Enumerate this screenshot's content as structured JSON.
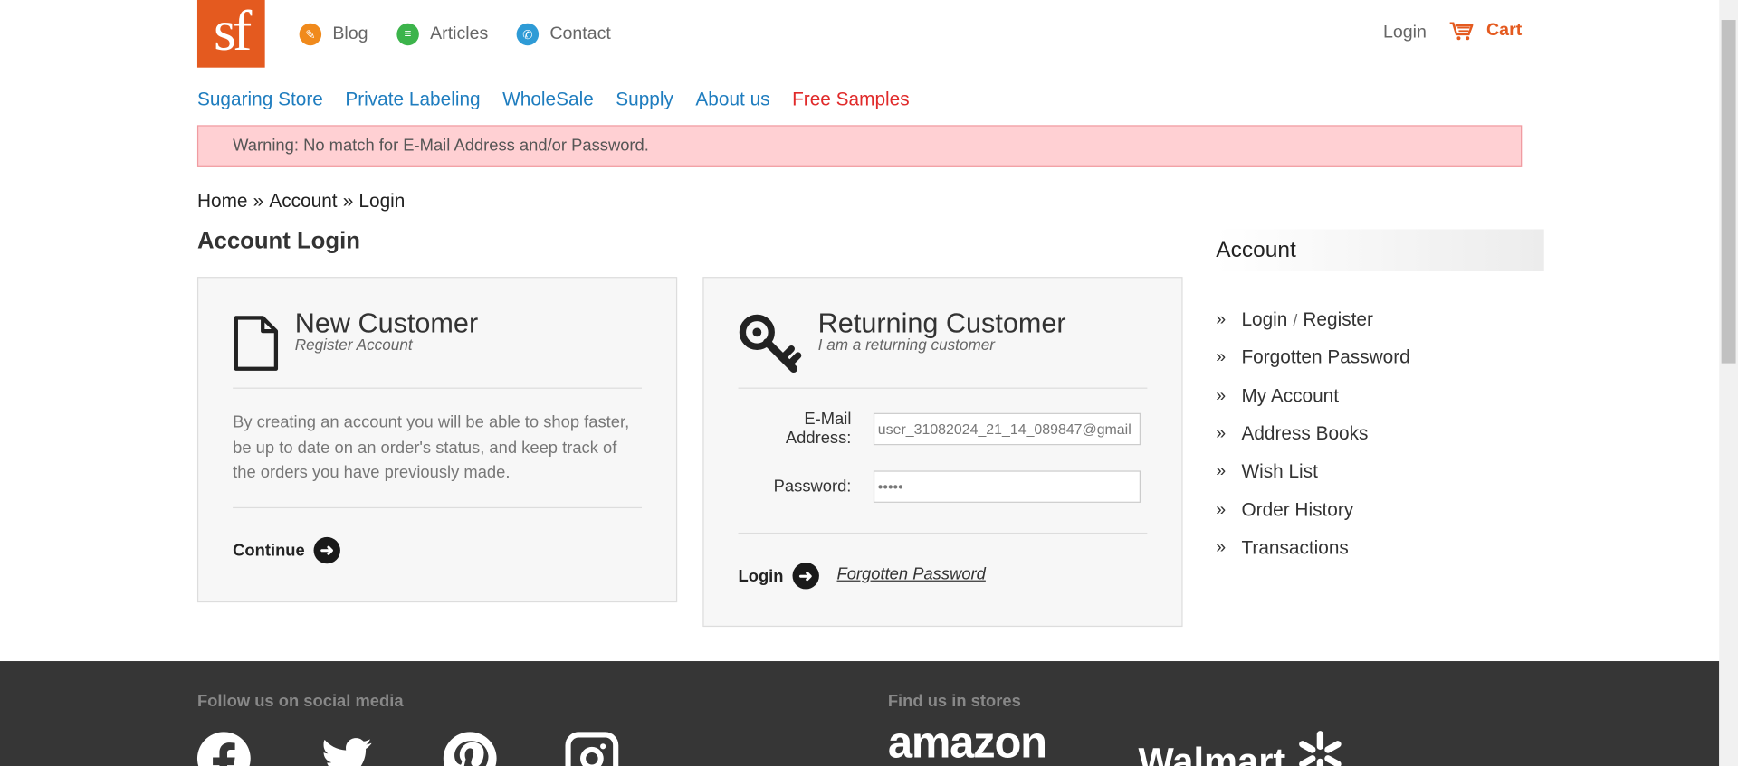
{
  "brand": {
    "logo_text": "sf",
    "accent": "#e45a1f"
  },
  "top_links": [
    {
      "label": "Blog",
      "icon": "pencil-icon",
      "color": "#f08a1c"
    },
    {
      "label": "Articles",
      "icon": "document-icon",
      "color": "#3cb44b"
    },
    {
      "label": "Contact",
      "icon": "phone-icon",
      "color": "#2e9bd6"
    }
  ],
  "header": {
    "login_label": "Login",
    "cart_label": "Cart"
  },
  "nav": [
    {
      "label": "Sugaring Store"
    },
    {
      "label": "Private Labeling"
    },
    {
      "label": "WholeSale"
    },
    {
      "label": "Supply"
    },
    {
      "label": "About us"
    },
    {
      "label": "Free Samples"
    }
  ],
  "alert": {
    "text": "Warning: No match for E-Mail Address and/or Password."
  },
  "breadcrumb": {
    "home": "Home",
    "sep": "»",
    "account": "Account",
    "login": "Login"
  },
  "page": {
    "title": "Account Login"
  },
  "new_customer": {
    "title": "New Customer",
    "subtitle": "Register Account",
    "description": "By creating an account you will be able to shop faster, be up to date on an order's status, and keep track of the orders you have previously made.",
    "continue_label": "Continue"
  },
  "returning_customer": {
    "title": "Returning Customer",
    "subtitle": "I am a returning customer",
    "email_label": "E-Mail Address:",
    "email_value": "user_31082024_21_14_089847@gmail",
    "password_label": "Password:",
    "password_value": "•••••",
    "login_label": "Login",
    "forgotten_label": "Forgotten Password"
  },
  "sidebar": {
    "title": "Account",
    "items": [
      {
        "label": "Login",
        "label2": "Register",
        "slash": "/"
      },
      {
        "label": "Forgotten Password"
      },
      {
        "label": "My Account"
      },
      {
        "label": "Address Books"
      },
      {
        "label": "Wish List"
      },
      {
        "label": "Order History"
      },
      {
        "label": "Transactions"
      }
    ]
  },
  "footer": {
    "social_heading": "Follow us on social media",
    "stores_heading": "Find us in stores",
    "amazon": "amazon",
    "walmart": "Walmart"
  }
}
